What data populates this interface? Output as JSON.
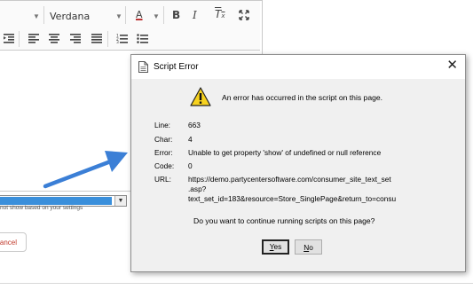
{
  "editor": {
    "font_name": "Verdana",
    "hint_text": "not show based on your settings",
    "cancel_label": "ancel"
  },
  "dialog": {
    "title": "Script Error",
    "headline": "An error has occurred in the script on this page.",
    "fields": [
      {
        "label": "Line:",
        "value": "663"
      },
      {
        "label": "Char:",
        "value": "4"
      },
      {
        "label": "Error:",
        "value": "Unable to get property 'show' of undefined or null reference"
      },
      {
        "label": "Code:",
        "value": "0"
      },
      {
        "label": "URL:",
        "value_lines": [
          "https://demo.partycentersoftware.com/consumer_site_text_set",
          ".asp?",
          "text_set_id=183&resource=Store_SinglePage&return_to=consu"
        ]
      }
    ],
    "question": "Do you want to continue running scripts on this page?",
    "yes_label": "Yes",
    "no_label": "No",
    "yes_accel": "Y",
    "yes_rest": "es",
    "no_accel": "N",
    "no_rest": "o"
  },
  "colors": {
    "arrow": "#3b7fd6",
    "select_fill": "#3a8fdb",
    "warning": "#f7d21e"
  },
  "icons": [
    "dropdown-caret-icon",
    "text-color-icon",
    "bold-icon",
    "italic-icon",
    "clear-format-icon",
    "maximize-icon",
    "indent-icon",
    "align-left-icon",
    "align-center-icon",
    "align-right-icon",
    "justify-icon",
    "ordered-list-icon",
    "unordered-list-icon",
    "document-icon",
    "close-icon",
    "warning-icon",
    "annotation-arrow"
  ]
}
